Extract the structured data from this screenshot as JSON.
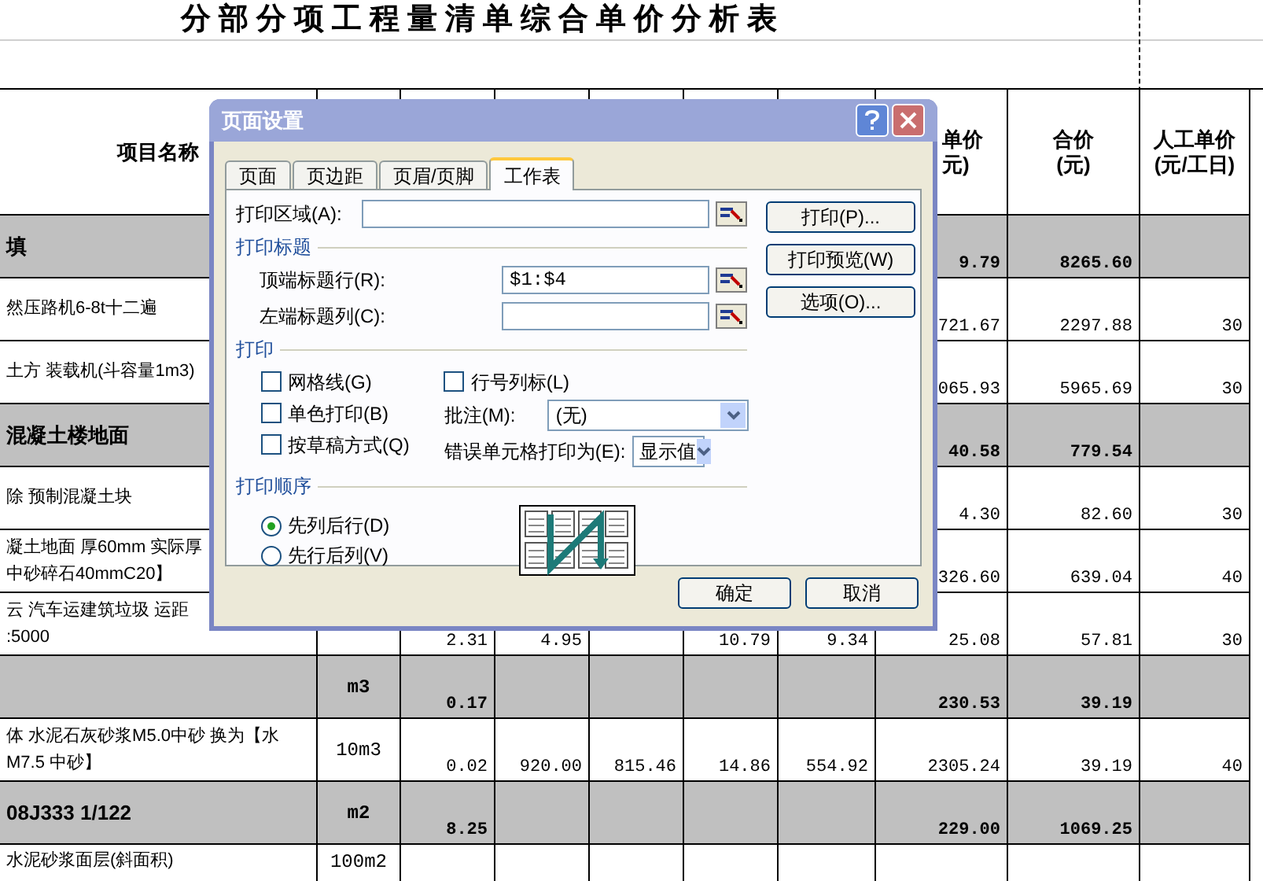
{
  "sheet": {
    "title": "分部分项工程量清单综合单价分析表",
    "header": {
      "name": "项目名称",
      "col_h": [
        "单价",
        "元)"
      ],
      "total": [
        "合价",
        "(元)"
      ],
      "labor_rate": [
        "人工单价",
        "(元/工日)"
      ]
    },
    "rows": [
      {
        "kind": "group",
        "cells": [
          [
            "填"
          ],
          null,
          null,
          null,
          null,
          null,
          null,
          "9.79",
          "8265.60",
          null
        ]
      },
      {
        "kind": "item",
        "cells": [
          [
            "然压路机6-8t十二遍"
          ],
          null,
          null,
          null,
          null,
          null,
          null,
          "721.67",
          "2297.88",
          "30"
        ]
      },
      {
        "kind": "item",
        "cells": [
          [
            "土方 装载机(斗容量1m3)"
          ],
          null,
          null,
          null,
          null,
          null,
          null,
          "065.93",
          "5965.69",
          "30"
        ]
      },
      {
        "kind": "group",
        "cells": [
          [
            "混凝土楼地面"
          ],
          null,
          null,
          null,
          null,
          null,
          null,
          "40.58",
          "779.54",
          null
        ]
      },
      {
        "kind": "item",
        "cells": [
          [
            "除 预制混凝土块"
          ],
          null,
          null,
          null,
          null,
          null,
          null,
          "4.30",
          "82.60",
          "30"
        ]
      },
      {
        "kind": "item",
        "cells": [
          [
            "凝土地面 厚60mm 实际厚",
            "中砂碎石40mmC20】"
          ],
          null,
          null,
          null,
          null,
          null,
          null,
          "326.60",
          "639.04",
          "40"
        ]
      },
      {
        "kind": "item",
        "cells": [
          [
            "云 汽车运建筑垃圾 运距",
            ":5000"
          ],
          null,
          "2.31",
          "4.95",
          null,
          "10.79",
          "9.34",
          "25.08",
          "57.81",
          "30"
        ]
      },
      {
        "kind": "group",
        "cells": [
          null,
          "m3",
          "0.17",
          null,
          null,
          null,
          null,
          "230.53",
          "39.19",
          null
        ]
      },
      {
        "kind": "item",
        "cells": [
          [
            "体 水泥石灰砂浆M5.0中砂 换为【水",
            "M7.5 中砂】"
          ],
          "10m3",
          "0.02",
          "920.00",
          "815.46",
          "14.86",
          "554.92",
          "2305.24",
          "39.19",
          "40"
        ]
      },
      {
        "kind": "group",
        "cells": [
          [
            "08J333 1/122"
          ],
          "m2",
          "8.25",
          null,
          null,
          null,
          null,
          "229.00",
          "1069.25",
          null
        ]
      },
      {
        "kind": "item",
        "cells": [
          [
            "水泥砂浆面层(斜面积)"
          ],
          "100m2",
          null,
          null,
          null,
          null,
          null,
          null,
          null,
          null
        ]
      }
    ]
  },
  "dialog": {
    "title": "页面设置",
    "tabs": [
      {
        "label": "页面",
        "selected": false
      },
      {
        "label": "页边距",
        "selected": false
      },
      {
        "label": "页眉/页脚",
        "selected": false
      },
      {
        "label": "工作表",
        "selected": true
      }
    ],
    "print_area": {
      "label": "打印区域(A):"
    },
    "print_titles": {
      "heading": "打印标题",
      "rows_to_repeat": {
        "label": "顶端标题行(R):",
        "value": "$1:$4"
      },
      "columns_to_repeat": {
        "label": "左端标题列(C):"
      }
    },
    "print": {
      "heading": "打印",
      "options": [
        {
          "label": "网格线(G)",
          "checked": false
        },
        {
          "label": "单色打印(B)",
          "checked": false
        },
        {
          "label": "按草稿方式(Q)",
          "checked": false
        },
        {
          "label": "行号列标(L)",
          "checked": false
        }
      ],
      "comments": {
        "label": "批注(M):",
        "value": "(无)"
      },
      "cell_errors": {
        "label": "错误单元格打印为(E):",
        "value": "显示值"
      }
    },
    "page_order": {
      "heading": "打印顺序",
      "options": [
        {
          "label": "先列后行(D)",
          "selected": true
        },
        {
          "label": "先行后列(V)",
          "selected": false
        }
      ]
    },
    "side_buttons": [
      "打印(P)...",
      "打印预览(W)",
      "选项(O)..."
    ],
    "buttons": [
      "确定",
      "取消"
    ]
  }
}
